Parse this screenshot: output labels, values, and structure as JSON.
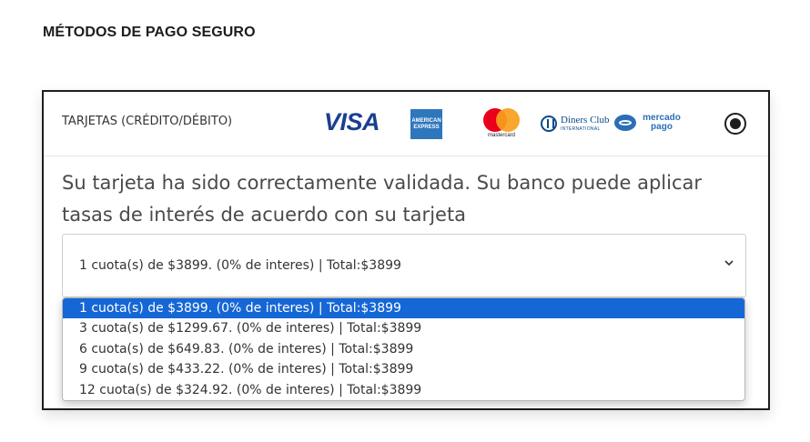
{
  "section_title": "MÉTODOS DE PAGO SEGURO",
  "payment_method": {
    "label": "TARJETAS (CRÉDITO/DÉBITO)",
    "selected": true,
    "logos": {
      "visa": "VISA",
      "amex": "AMERICAN EXPRESS",
      "mastercard": "mastercard",
      "diners_top": "Diners Club",
      "diners_bottom": "INTERNATIONAL",
      "mercadopago": "mercado pago"
    }
  },
  "message": "Su tarjeta ha sido correctamente validada. Su banco puede aplicar tasas de interés de acuerdo con su tarjeta",
  "installments": {
    "selected_value": "1 cuota(s) de $3899. (0% de interes) | Total:$3899",
    "options": [
      "1 cuota(s) de $3899. (0% de interes) | Total:$3899",
      "3 cuota(s) de $1299.67. (0% de interes) | Total:$3899",
      "6 cuota(s) de $649.83. (0% de interes) | Total:$3899",
      "9 cuota(s) de $433.22. (0% de interes) | Total:$3899",
      "12 cuota(s) de $324.92. (0% de interes) | Total:$3899"
    ],
    "highlighted_index": 0
  },
  "colors": {
    "highlight": "#1667d6",
    "visa": "#1a3f8f",
    "amex": "#2e77bc",
    "mastercard_red": "#eb001b",
    "mastercard_orange": "#f79e1b"
  }
}
